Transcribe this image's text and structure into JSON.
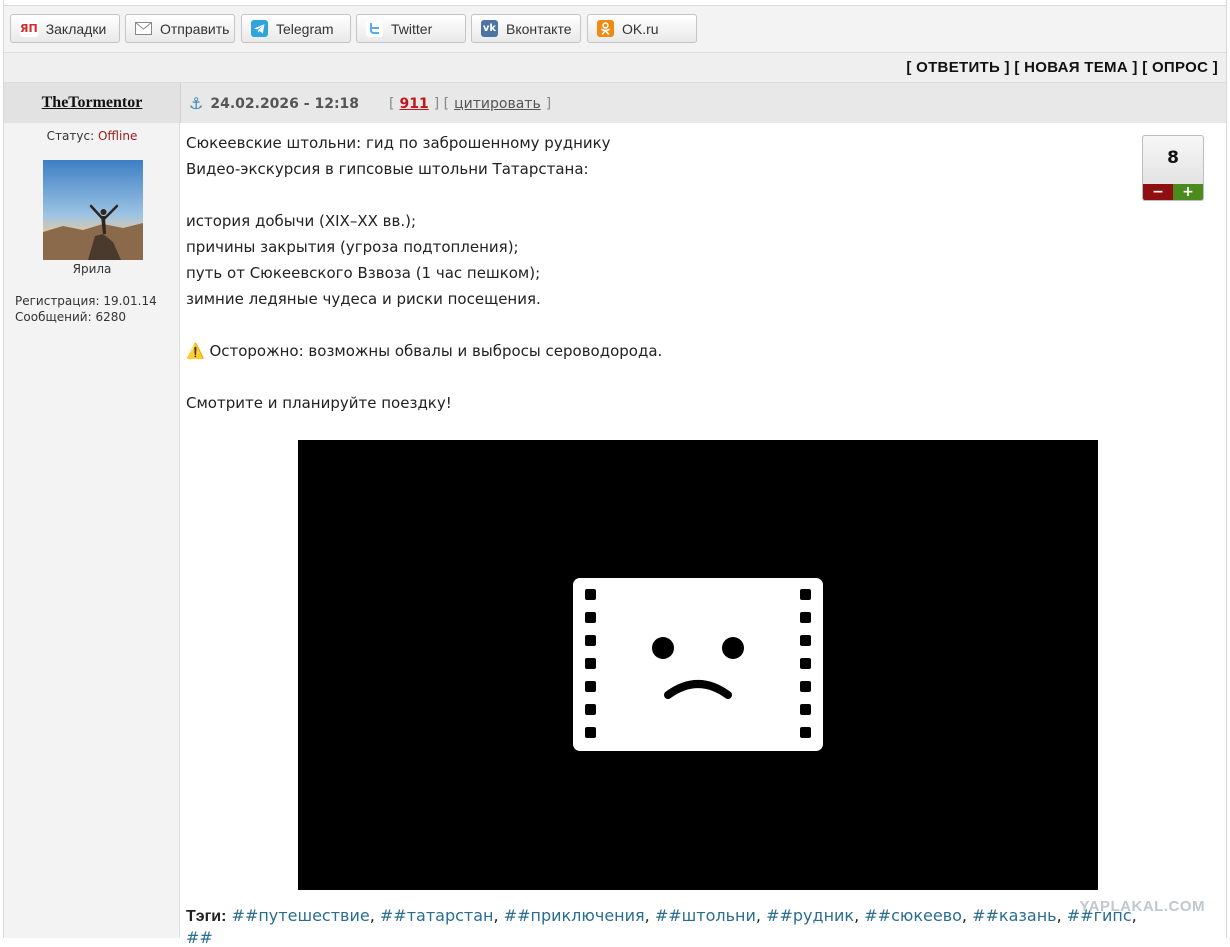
{
  "share_bar": {
    "buttons": [
      {
        "label": "Закладки",
        "icon": "yandex-bookmarks-icon",
        "icon_text": "ЯП",
        "color": "#ffffff",
        "text_color": "#d32b2b"
      },
      {
        "label": "Отправить",
        "icon": "envelope-icon",
        "icon_text": "",
        "color": "#ffffff",
        "text_color": "#777777"
      },
      {
        "label": "Telegram",
        "icon": "telegram-icon",
        "icon_text": "",
        "color": "#30a5dd",
        "text_color": "#ffffff"
      },
      {
        "label": "Twitter",
        "icon": "twitter-icon",
        "icon_text": "",
        "color": "#ffffff",
        "text_color": "#55acee"
      },
      {
        "label": "Вконтакте",
        "icon": "vk-icon",
        "icon_text": "",
        "color": "#4c75a3",
        "text_color": "#ffffff"
      },
      {
        "label": "OK.ru",
        "icon": "odnoklassniki-icon",
        "icon_text": "",
        "color": "#f08a12",
        "text_color": "#ffffff"
      }
    ]
  },
  "actions": {
    "reply": "ОТВЕТИТЬ",
    "new_topic": "НОВАЯ ТЕМА",
    "poll": "ОПРОС"
  },
  "post": {
    "author": "TheTormentor",
    "date": "24.02.2026 - 12:18",
    "rating_link": "911",
    "quote_link": "цитировать",
    "status_label": "Статус:",
    "status_value": "Offline",
    "avatar_caption": "Ярила",
    "registration": "Регистрация: 19.01.14",
    "messages": "Сообщений: 6280",
    "rating": "8",
    "rating_minus": "−",
    "rating_plus": "+",
    "body": [
      "Сюкеевские штольни: гид по заброшенному руднику",
      "Видео-экскурсия в гипсовые штольни Татарстана:",
      "",
      "история добычи (XIX–XX вв.);",
      "причины закрытия (угроза подтопления);",
      "путь от Сюкеевского Взвоза (1 час пешком);",
      "зимние ледяные чудеса и риски посещения.",
      "",
      "⚠️ Осторожно: возможны обвалы и выбросы сероводорода.",
      "",
      "Смотрите и планируйте поездку!"
    ],
    "tags_label": "Тэги:",
    "tags": [
      "##путешествие",
      "##татарстан",
      "##приключения",
      "##штольни",
      "##рудник",
      "##сюкеево",
      "##казань",
      "##гипс"
    ],
    "tags_overflow": "##"
  },
  "watermark": "YAPLAKAL.COM"
}
